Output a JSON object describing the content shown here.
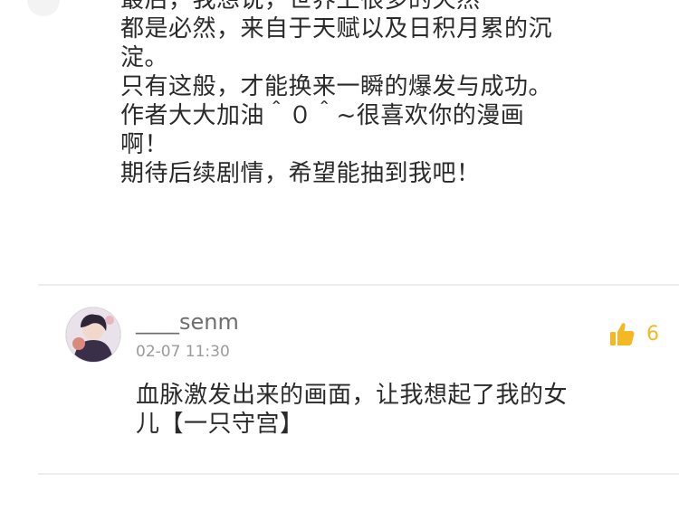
{
  "previous_comment": {
    "lines": [
      "最后，我想说，世界上很多的天然",
      "都是必然，来自于天赋以及日积月累的沉",
      "淀。",
      "只有这般，才能换来一瞬的爆发与成功。",
      "作者大大加油＾０＾~很喜欢你的漫画",
      "啊！",
      "期待后续剧情，希望能抽到我吧！"
    ]
  },
  "comment": {
    "username": "____senm",
    "timestamp": "02-07 11:30",
    "likes": "6",
    "body_lines": [
      "血脉激发出来的画面，让我想起了我的女",
      "儿【一只守宫】"
    ]
  },
  "icons": {
    "like": "thumbs-up-icon",
    "avatar": "user-avatar"
  },
  "colors": {
    "accent": "#f3b824",
    "text": "#2a2a2a",
    "secondary_text": "#6e6e6e",
    "muted_text": "#9a9a9a",
    "divider": "#ededed"
  }
}
